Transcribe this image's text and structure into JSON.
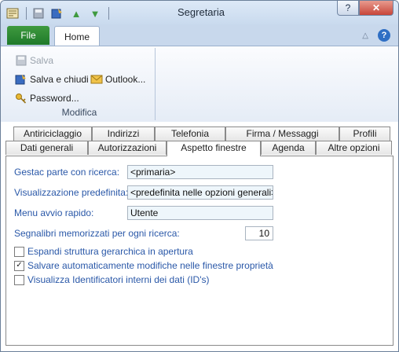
{
  "window": {
    "title": "Segretaria",
    "help_label": "?",
    "close_label": "✕"
  },
  "qat": {
    "icons": [
      "app-icon",
      "save-icon",
      "save-close-icon",
      "up-arrow-icon",
      "down-arrow-icon"
    ]
  },
  "ribbon": {
    "tabs": [
      "File",
      "Home"
    ],
    "collapse_glyph": "△",
    "help_glyph": "?",
    "group_label": "Modifica",
    "buttons": {
      "save": "Salva",
      "save_close": "Salva e chiudi",
      "outlook": "Outlook...",
      "password": "Password..."
    }
  },
  "tabs": {
    "row1": [
      "Antiriciclaggio",
      "Indirizzi",
      "Telefonia",
      "Firma / Messaggi",
      "Profili"
    ],
    "row2": [
      "Dati generali",
      "Autorizzazioni",
      "Aspetto finestre",
      "Agenda",
      "Altre opzioni"
    ],
    "active": "Aspetto finestre"
  },
  "form": {
    "gestac_label": "Gestac parte con ricerca:",
    "gestac_value": "<primaria>",
    "visual_label": "Visualizzazione predefinita:",
    "visual_value": "<predefinita nelle opzioni generali>",
    "menu_label": "Menu avvio rapido:",
    "menu_value": "Utente",
    "segnalibri_label": "Segnalibri memorizzati per ogni ricerca:",
    "segnalibri_value": "10",
    "checkboxes": [
      {
        "label": "Espandi struttura gerarchica in apertura",
        "checked": false
      },
      {
        "label": "Salvare automaticamente modifiche nelle finestre proprietà",
        "checked": true
      },
      {
        "label": "Visualizza Identificatori interni dei dati (ID's)",
        "checked": false
      }
    ]
  },
  "colors": {
    "label_blue": "#2a58a8",
    "file_tab_green": "#2b8a2f",
    "field_bg": "#eef6fb"
  }
}
